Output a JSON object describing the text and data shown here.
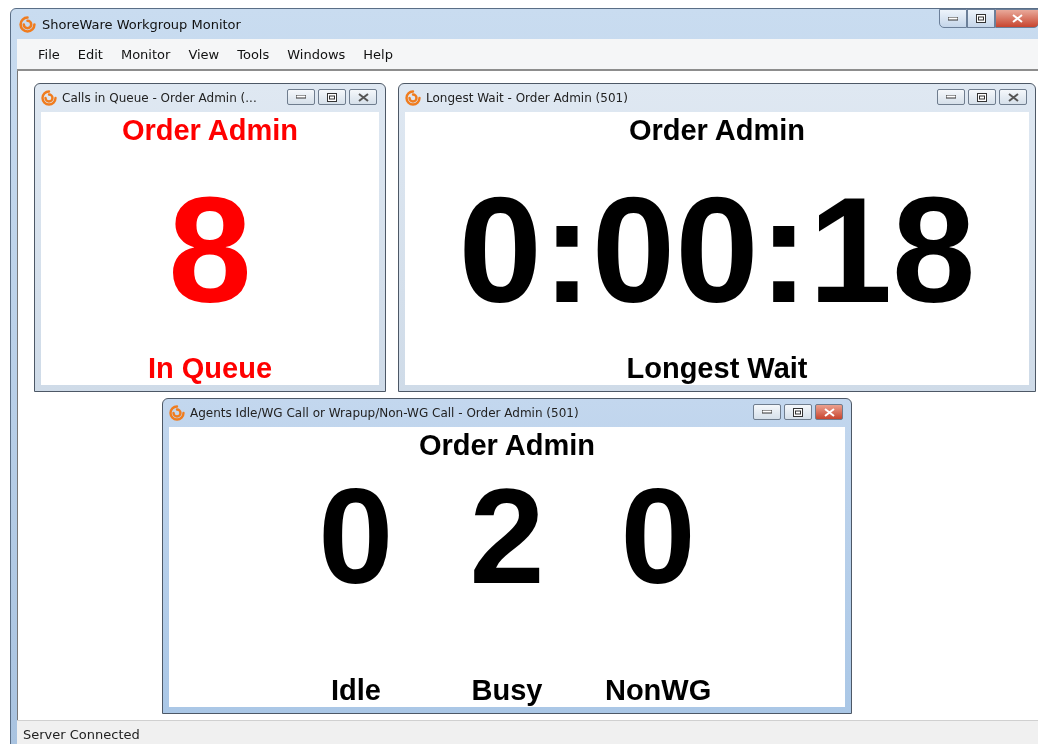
{
  "window": {
    "title": "ShoreWare Workgroup Monitor"
  },
  "menu": [
    "File",
    "Edit",
    "Monitor",
    "View",
    "Tools",
    "Windows",
    "Help"
  ],
  "child_windows": [
    {
      "kind": "count",
      "title": "Calls in Queue - Order Admin (...",
      "heading": "Order Admin",
      "value": "8",
      "label": "In Queue",
      "alert": true,
      "active": false
    },
    {
      "kind": "count",
      "title": "Longest Wait - Order Admin (501)",
      "heading": "Order Admin",
      "value": "0:00:18",
      "label": "Longest Wait",
      "alert": false,
      "active": false
    },
    {
      "kind": "agents",
      "title": "Agents Idle/WG Call or Wrapup/Non-WG Call - Order Admin (501)",
      "heading": "Order Admin",
      "alert": false,
      "active": true,
      "counts": [
        {
          "value": "0",
          "label": "Idle"
        },
        {
          "value": "2",
          "label": "Busy"
        },
        {
          "value": "0",
          "label": "NonWG"
        }
      ]
    }
  ],
  "status_bar": "Server Connected"
}
